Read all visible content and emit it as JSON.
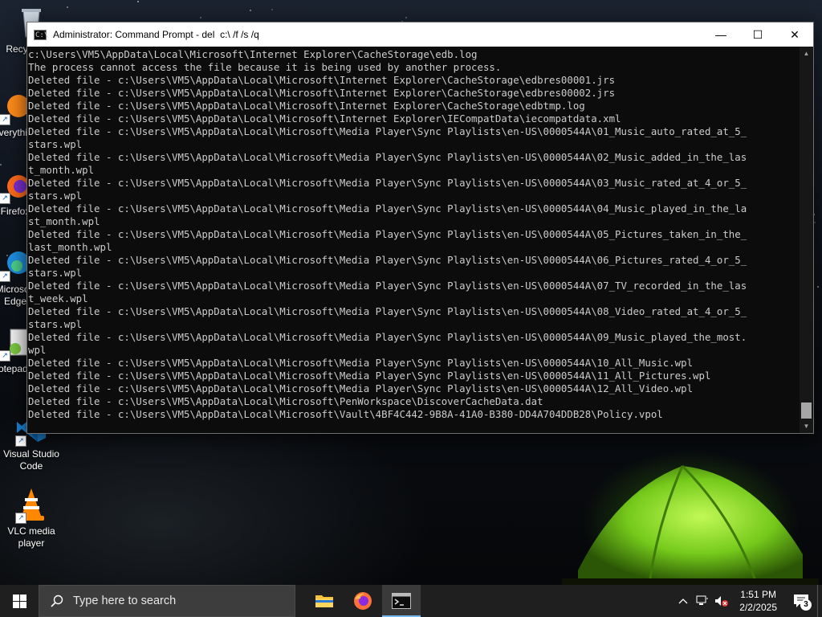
{
  "desktop": {
    "icons": [
      {
        "label": "Recycle Bin",
        "icon": "recycle-bin-icon"
      },
      {
        "label": "Everything",
        "icon": "everything-icon"
      },
      {
        "label": "Firefox",
        "icon": "firefox-icon"
      },
      {
        "label": "Microsoft Edge",
        "icon": "edge-icon"
      },
      {
        "label": "Notepad++",
        "icon": "notepad-plus-plus-icon"
      },
      {
        "label": "Visual Studio Code",
        "icon": "vscode-icon"
      },
      {
        "label": "VLC media player",
        "icon": "vlc-icon"
      }
    ]
  },
  "cmd_window": {
    "title": "Administrator: Command Prompt - del  c:\\ /f /s /q",
    "controls": {
      "minimize": "—",
      "maximize": "☐",
      "close": "✕"
    },
    "lines": [
      "c:\\Users\\VM5\\AppData\\Local\\Microsoft\\Internet Explorer\\CacheStorage\\edb.log",
      "The process cannot access the file because it is being used by another process.",
      "Deleted file - c:\\Users\\VM5\\AppData\\Local\\Microsoft\\Internet Explorer\\CacheStorage\\edbres00001.jrs",
      "Deleted file - c:\\Users\\VM5\\AppData\\Local\\Microsoft\\Internet Explorer\\CacheStorage\\edbres00002.jrs",
      "Deleted file - c:\\Users\\VM5\\AppData\\Local\\Microsoft\\Internet Explorer\\CacheStorage\\edbtmp.log",
      "Deleted file - c:\\Users\\VM5\\AppData\\Local\\Microsoft\\Internet Explorer\\IECompatData\\iecompatdata.xml",
      "Deleted file - c:\\Users\\VM5\\AppData\\Local\\Microsoft\\Media Player\\Sync Playlists\\en-US\\0000544A\\01_Music_auto_rated_at_5_",
      "stars.wpl",
      "Deleted file - c:\\Users\\VM5\\AppData\\Local\\Microsoft\\Media Player\\Sync Playlists\\en-US\\0000544A\\02_Music_added_in_the_las",
      "t_month.wpl",
      "Deleted file - c:\\Users\\VM5\\AppData\\Local\\Microsoft\\Media Player\\Sync Playlists\\en-US\\0000544A\\03_Music_rated_at_4_or_5_",
      "stars.wpl",
      "Deleted file - c:\\Users\\VM5\\AppData\\Local\\Microsoft\\Media Player\\Sync Playlists\\en-US\\0000544A\\04_Music_played_in_the_la",
      "st_month.wpl",
      "Deleted file - c:\\Users\\VM5\\AppData\\Local\\Microsoft\\Media Player\\Sync Playlists\\en-US\\0000544A\\05_Pictures_taken_in_the_",
      "last_month.wpl",
      "Deleted file - c:\\Users\\VM5\\AppData\\Local\\Microsoft\\Media Player\\Sync Playlists\\en-US\\0000544A\\06_Pictures_rated_4_or_5_",
      "stars.wpl",
      "Deleted file - c:\\Users\\VM5\\AppData\\Local\\Microsoft\\Media Player\\Sync Playlists\\en-US\\0000544A\\07_TV_recorded_in_the_las",
      "t_week.wpl",
      "Deleted file - c:\\Users\\VM5\\AppData\\Local\\Microsoft\\Media Player\\Sync Playlists\\en-US\\0000544A\\08_Video_rated_at_4_or_5_",
      "stars.wpl",
      "Deleted file - c:\\Users\\VM5\\AppData\\Local\\Microsoft\\Media Player\\Sync Playlists\\en-US\\0000544A\\09_Music_played_the_most.",
      "wpl",
      "Deleted file - c:\\Users\\VM5\\AppData\\Local\\Microsoft\\Media Player\\Sync Playlists\\en-US\\0000544A\\10_All_Music.wpl",
      "Deleted file - c:\\Users\\VM5\\AppData\\Local\\Microsoft\\Media Player\\Sync Playlists\\en-US\\0000544A\\11_All_Pictures.wpl",
      "Deleted file - c:\\Users\\VM5\\AppData\\Local\\Microsoft\\Media Player\\Sync Playlists\\en-US\\0000544A\\12_All_Video.wpl",
      "Deleted file - c:\\Users\\VM5\\AppData\\Local\\Microsoft\\PenWorkspace\\DiscoverCacheData.dat",
      "Deleted file - c:\\Users\\VM5\\AppData\\Local\\Microsoft\\Vault\\4BF4C442-9B8A-41A0-B380-DD4A704DDB28\\Policy.vpol"
    ]
  },
  "taskbar": {
    "search_placeholder": "Type here to search",
    "apps": [
      {
        "name": "file-explorer",
        "icon": "folder-icon",
        "active": false
      },
      {
        "name": "firefox",
        "icon": "firefox-icon",
        "active": false
      },
      {
        "name": "command-prompt",
        "icon": "terminal-icon",
        "active": true
      }
    ],
    "clock": {
      "time": "1:51 PM",
      "date": "2/2/2025"
    },
    "notification_count": "3"
  },
  "colors": {
    "console_bg": "#0c0c0c",
    "console_fg": "#cccccc",
    "taskbar_bg": "#1f1f1f",
    "accent": "#76b9ed"
  }
}
